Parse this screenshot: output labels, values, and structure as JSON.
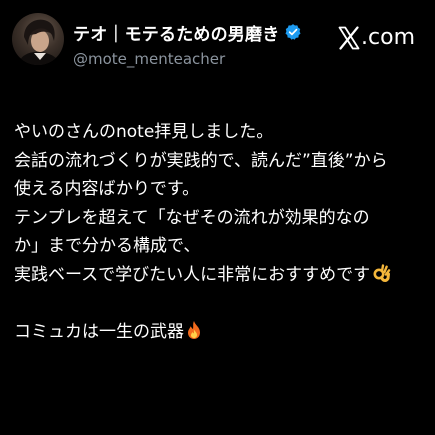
{
  "post": {
    "author": {
      "display_name": "テオ｜モテるための男磨き",
      "handle": "@mote_menteacher",
      "verified": true,
      "verified_badge_color": "#1d9bf0"
    },
    "brand": {
      "icon": "x-logo-icon",
      "suffix": ".com"
    },
    "lines": [
      "やいのさんのnote拝見しました。",
      "会話の流れづくりが実践的で、読んだ”直後”から",
      "使える内容ばかりです。",
      "テンプレを超えて「なぜその流れが効果的なの",
      "か」まで分かる構成で、",
      "実践ベースで学びたい人に非常におすすめです",
      "",
      "コミュカは一生の武器"
    ],
    "emojis": {
      "line_6": "ok-hand-emoji",
      "line_8": "fire-emoji"
    }
  },
  "colors": {
    "background": "#000000",
    "text": "#ffffff",
    "handle_text": "#8b949e"
  }
}
